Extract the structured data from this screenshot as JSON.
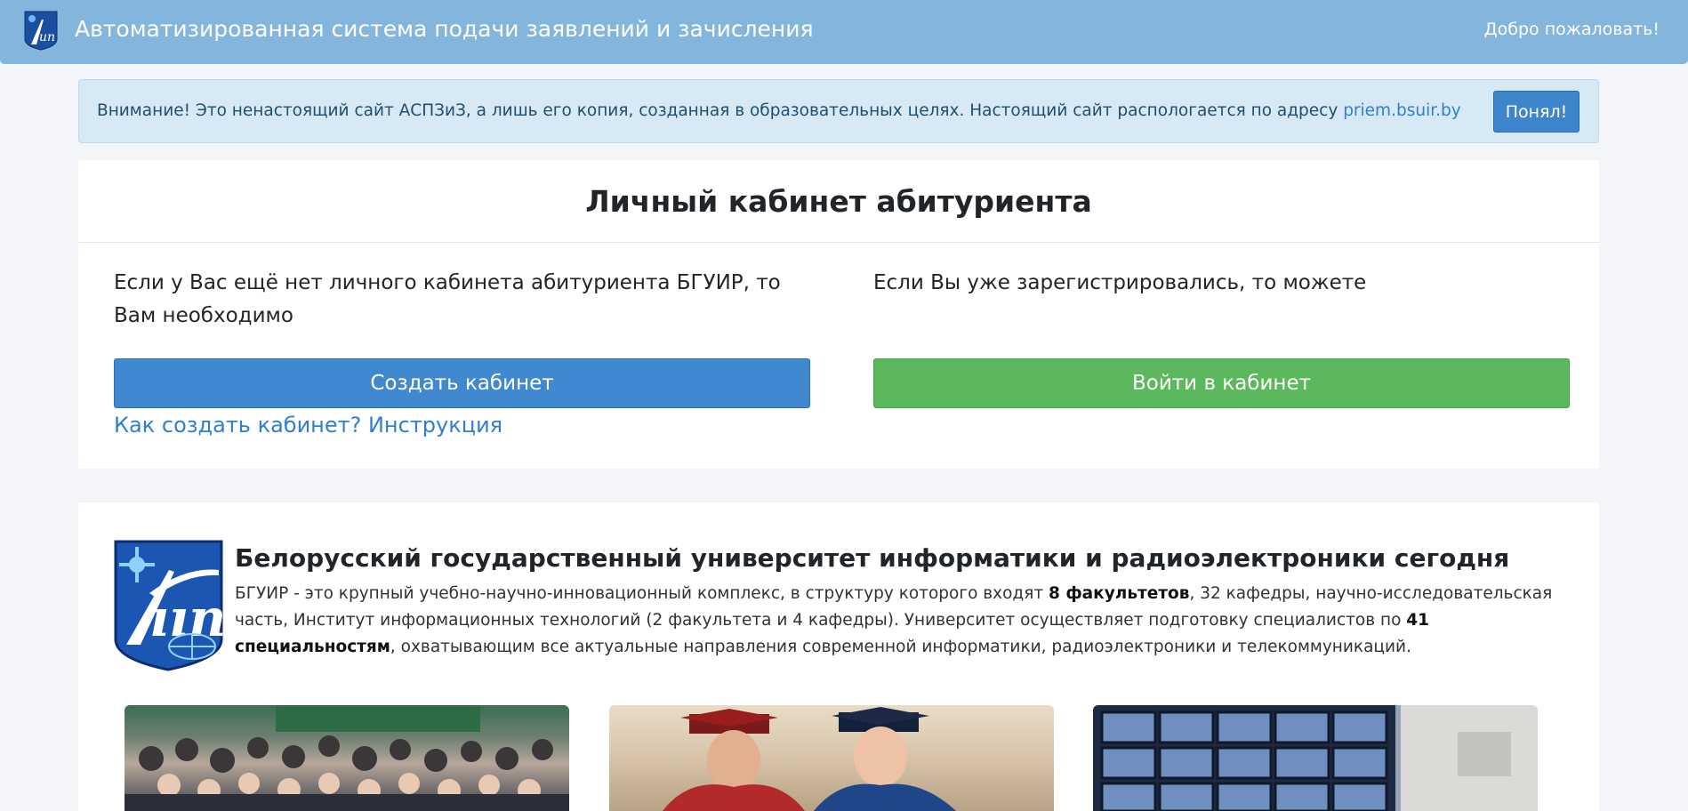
{
  "navbar": {
    "title": "Автоматизированная система подачи заявлений и зачисления",
    "welcome": "Добро пожаловать!",
    "brand_color": "#84b6dd"
  },
  "alert": {
    "text": "Внимание! Это ненастоящий сайт АСПЗиЗ, а лишь его копия, созданная в образовательных целях. Настоящий сайт распологается по адресу ",
    "link": "priem.bsuir.by",
    "button": "Понял!"
  },
  "cabinet": {
    "title": "Личный кабинет абитуриента",
    "left_text": "Если у Вас ещё нет личного кабинета абитуриента БГУИР, то Вам необходимо",
    "right_text": "Если Вы уже зарегистрировались, то можете",
    "create_button": "Создать кабинет",
    "login_button": "Войти в кабинет",
    "help_link": "Как создать кабинет? Инструкция"
  },
  "university": {
    "title": "Белорусский государственный университет информатики и радиоэлектроники сегодня",
    "desc_1": "БГУИР - это крупный учебно-научно-инновационный комплекс, в структуру которого входят ",
    "desc_bold_1": "8 факультетов",
    "desc_2": ", 32 кафедры, научно-исследовательская часть, Институт информационных технологий (2 факультета и 4 кафедры). Университет осуществляет подготовку специалистов по ",
    "desc_bold_2": "41 специальностям",
    "desc_3": ", охватывающим все актуальные направления современной информатики, радиоэлектроники и телекоммуникаций."
  },
  "colors": {
    "primary": "#4089d0",
    "success": "#5cb85c",
    "link": "#2f7fd1",
    "alert_bg": "#d8e9f6"
  }
}
